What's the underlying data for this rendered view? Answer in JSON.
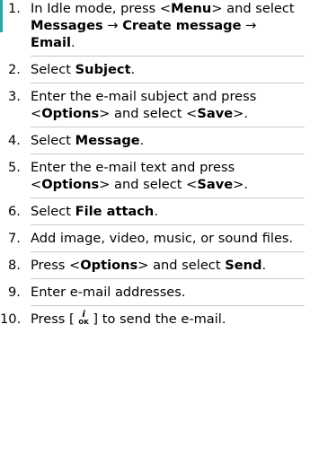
{
  "steps": [
    {
      "number": "1.",
      "parts": [
        {
          "t": "In Idle mode, press <"
        },
        {
          "t": "Menu",
          "b": true
        },
        {
          "t": "> and select "
        },
        {
          "t": "Messages",
          "b": true
        },
        {
          "t": " → "
        },
        {
          "t": "Create message",
          "b": true
        },
        {
          "t": " → "
        },
        {
          "t": "Email",
          "b": true
        },
        {
          "t": "."
        }
      ]
    },
    {
      "number": "2.",
      "parts": [
        {
          "t": "Select "
        },
        {
          "t": "Subject",
          "b": true
        },
        {
          "t": "."
        }
      ]
    },
    {
      "number": "3.",
      "parts": [
        {
          "t": "Enter the e-mail subject and press <"
        },
        {
          "t": "Options",
          "b": true
        },
        {
          "t": "> and select <"
        },
        {
          "t": "Save",
          "b": true
        },
        {
          "t": ">."
        }
      ]
    },
    {
      "number": "4.",
      "parts": [
        {
          "t": "Select "
        },
        {
          "t": "Message",
          "b": true
        },
        {
          "t": "."
        }
      ]
    },
    {
      "number": "5.",
      "parts": [
        {
          "t": "Enter the e-mail text and press <"
        },
        {
          "t": "Options",
          "b": true
        },
        {
          "t": "> and select <"
        },
        {
          "t": "Save",
          "b": true
        },
        {
          "t": ">."
        }
      ]
    },
    {
      "number": "6.",
      "parts": [
        {
          "t": "Select "
        },
        {
          "t": "File attach",
          "b": true
        },
        {
          "t": "."
        }
      ]
    },
    {
      "number": "7.",
      "parts": [
        {
          "t": "Add image, video, music, or sound files."
        }
      ]
    },
    {
      "number": "8.",
      "parts": [
        {
          "t": "Press <"
        },
        {
          "t": "Options",
          "b": true
        },
        {
          "t": "> and select "
        },
        {
          "t": "Send",
          "b": true
        },
        {
          "t": "."
        }
      ]
    },
    {
      "number": "9.",
      "parts": [
        {
          "t": "Enter e-mail addresses."
        }
      ]
    },
    {
      "number": "10.",
      "parts": [
        {
          "t": "Press [ "
        },
        {
          "t": "i",
          "key": "ok-key",
          "sub": "OK"
        },
        {
          "t": " ] to send the e-mail."
        }
      ]
    }
  ],
  "colors": {
    "accent": "#2aa6a6",
    "separator": "#c9c9c9",
    "text": "#000000"
  }
}
